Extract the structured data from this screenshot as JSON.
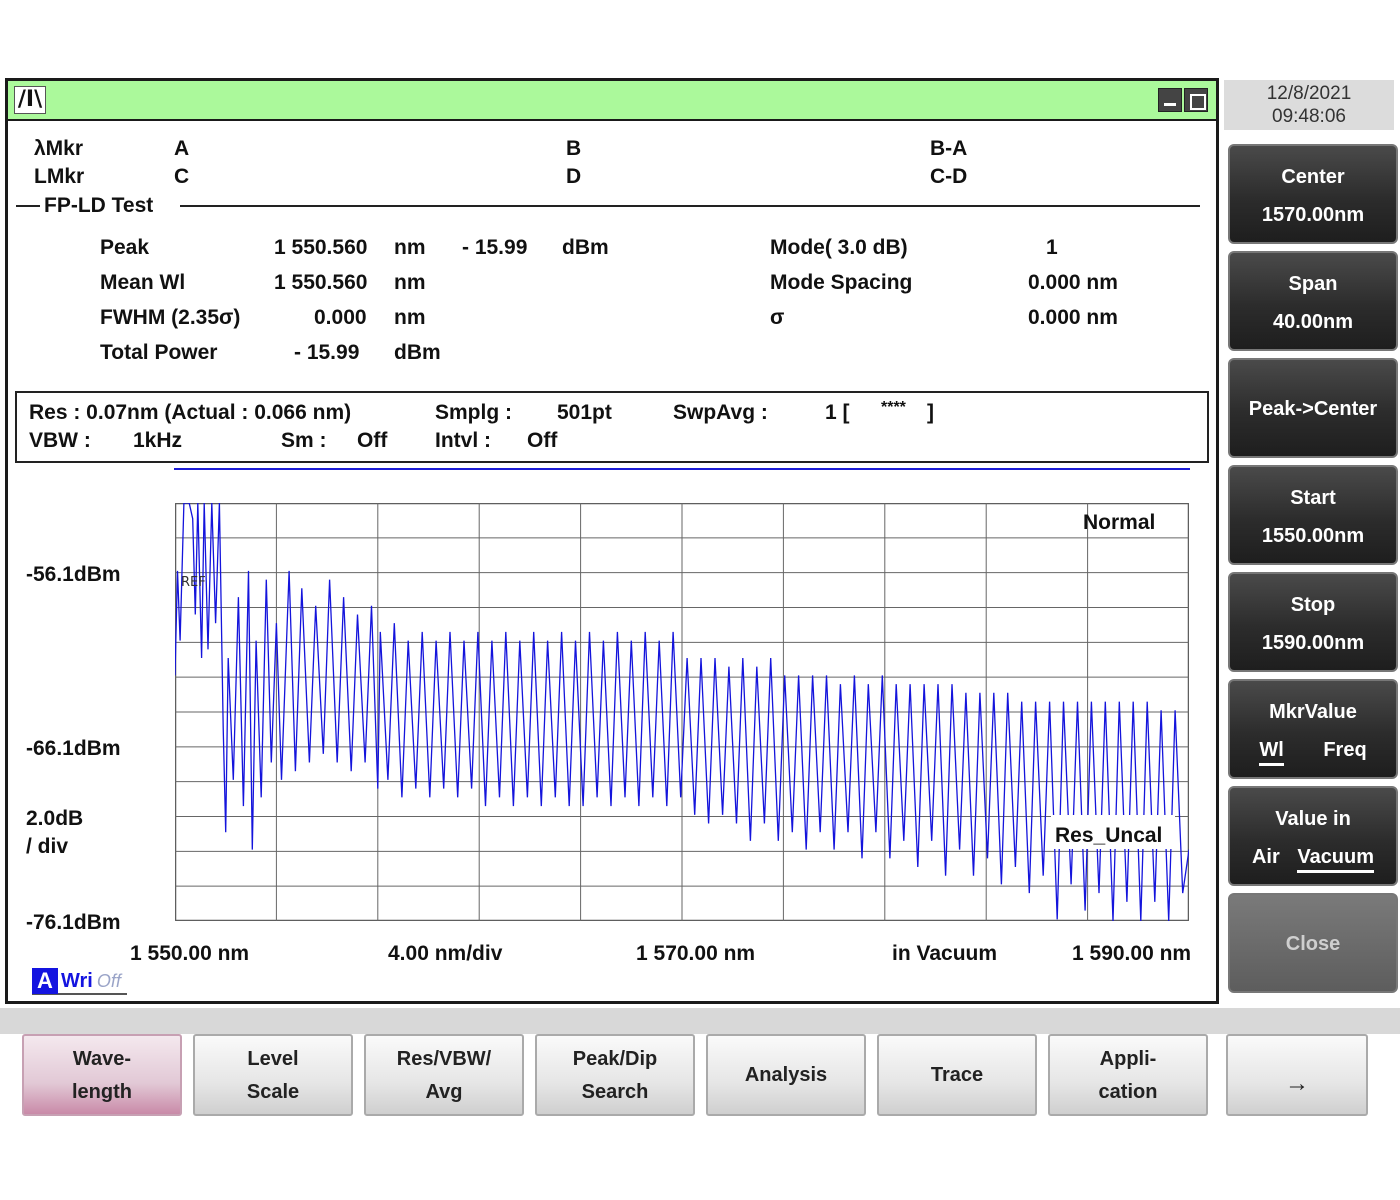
{
  "titlebar": {
    "logo": "/I\\"
  },
  "datetime": {
    "date": "12/8/2021",
    "time": "09:48:06"
  },
  "markers": {
    "lambda_label": "λMkr",
    "lambda_a": "A",
    "lambda_b": "B",
    "lambda_ba": "B-A",
    "level_label": "LMkr",
    "level_c": "C",
    "level_d": "D",
    "level_cd": "C-D"
  },
  "analysis": {
    "title": "FP-LD Test",
    "peak_label": "Peak",
    "peak_wl": "1 550.560",
    "peak_wl_unit": "nm",
    "peak_level": "- 15.99",
    "peak_level_unit": "dBm",
    "mean_label": "Mean Wl",
    "mean_wl": "1 550.560",
    "mean_unit": "nm",
    "fwhm_label": "FWHM (2.35σ)",
    "fwhm": "0.000",
    "fwhm_unit": "nm",
    "total_label": "Total Power",
    "total": "- 15.99",
    "total_unit": "dBm",
    "mode_label": "Mode(   3.0   dB)",
    "mode": "1",
    "spacing_label": "Mode Spacing",
    "spacing": "0.000 nm",
    "sigma_label": "σ",
    "sigma": "0.000 nm"
  },
  "settings": {
    "res": "Res :  0.07nm (Actual :  0.066 nm)",
    "smplg_label": "Smplg :",
    "smplg": "501pt",
    "swpavg_label": "SwpAvg :",
    "swpavg": "1 [",
    "swpavg_stars": "****",
    "swpavg_close": "]",
    "vbw_label": "VBW :",
    "vbw": "1kHz",
    "sm_label": "Sm :",
    "sm": "Off",
    "intvl_label": "Intvl :",
    "intvl": "Off"
  },
  "plot": {
    "y_top": "-56.1dBm",
    "y_mid": "-66.1dBm",
    "y_bottom": "-76.1dBm",
    "scale_1": "2.0dB",
    "scale_2": "/ div",
    "x_start": "1 550.00 nm",
    "x_div": "4.00 nm/div",
    "x_center": "1 570.00 nm",
    "x_medium": "in Vacuum",
    "x_stop": "1 590.00 nm",
    "mode_label": "Normal",
    "ref_label": "REF",
    "res_uncal": "Res_Uncal",
    "trace_a": "A",
    "trace_wri": "Wri",
    "trace_off": "Off"
  },
  "chart_data": {
    "type": "line",
    "xlabel": "",
    "ylabel": "",
    "xlim": [
      1550.0,
      1590.0
    ],
    "ylim": [
      -76.1,
      -52.1
    ],
    "grid": true,
    "x_ticks": [
      1550,
      1554,
      1558,
      1562,
      1566,
      1570,
      1574,
      1578,
      1582,
      1586,
      1590
    ],
    "y_gridlines_dB": 2.0,
    "color": "#1414dc",
    "series": [
      {
        "description_free": true,
        "points": [
          [
            1550.0,
            -62.0
          ],
          [
            1550.1,
            -56.0
          ],
          [
            1550.2,
            -60.0
          ],
          [
            1550.35,
            -52.1
          ],
          [
            1550.5,
            -52.1
          ],
          [
            1550.56,
            -52.1
          ],
          [
            1550.7,
            -53.0
          ],
          [
            1550.8,
            -58.5
          ],
          [
            1550.9,
            -52.1
          ],
          [
            1551.05,
            -61.0
          ],
          [
            1551.15,
            -52.1
          ],
          [
            1551.3,
            -60.5
          ],
          [
            1551.45,
            -52.1
          ],
          [
            1551.6,
            -59.0
          ],
          [
            1551.75,
            -52.1
          ],
          [
            1551.9,
            -65.0
          ],
          [
            1552.0,
            -71.0
          ],
          [
            1552.1,
            -61.0
          ],
          [
            1552.3,
            -68.0
          ],
          [
            1552.5,
            -57.5
          ],
          [
            1552.7,
            -69.5
          ],
          [
            1552.9,
            -56.0
          ],
          [
            1553.05,
            -72.0
          ],
          [
            1553.2,
            -60.0
          ],
          [
            1553.4,
            -69.0
          ],
          [
            1553.6,
            -56.5
          ],
          [
            1553.8,
            -67.0
          ],
          [
            1554.0,
            -59.0
          ],
          [
            1554.2,
            -68.0
          ],
          [
            1554.5,
            -56.0
          ],
          [
            1554.75,
            -67.5
          ],
          [
            1555.0,
            -57.0
          ],
          [
            1555.3,
            -67.0
          ],
          [
            1555.55,
            -58.0
          ],
          [
            1555.85,
            -66.5
          ],
          [
            1556.1,
            -56.5
          ],
          [
            1556.4,
            -67.0
          ],
          [
            1556.65,
            -57.5
          ],
          [
            1556.95,
            -67.5
          ],
          [
            1557.2,
            -58.5
          ],
          [
            1557.5,
            -67.0
          ],
          [
            1557.75,
            -58.0
          ],
          [
            1558.0,
            -68.5
          ],
          [
            1558.1,
            -59.5
          ],
          [
            1558.4,
            -68.0
          ],
          [
            1558.65,
            -59.0
          ],
          [
            1558.95,
            -69.0
          ],
          [
            1559.2,
            -60.0
          ],
          [
            1559.5,
            -68.5
          ],
          [
            1559.75,
            -59.5
          ],
          [
            1560.05,
            -69.0
          ],
          [
            1560.3,
            -60.0
          ],
          [
            1560.6,
            -68.5
          ],
          [
            1560.85,
            -59.5
          ],
          [
            1561.15,
            -69.0
          ],
          [
            1561.4,
            -60.0
          ],
          [
            1561.7,
            -68.5
          ],
          [
            1561.95,
            -59.5
          ],
          [
            1562.25,
            -69.5
          ],
          [
            1562.5,
            -60.0
          ],
          [
            1562.8,
            -69.0
          ],
          [
            1563.05,
            -59.5
          ],
          [
            1563.35,
            -69.5
          ],
          [
            1563.6,
            -60.0
          ],
          [
            1563.9,
            -69.0
          ],
          [
            1564.15,
            -59.5
          ],
          [
            1564.45,
            -69.5
          ],
          [
            1564.7,
            -60.0
          ],
          [
            1565.0,
            -69.0
          ],
          [
            1565.25,
            -59.5
          ],
          [
            1565.55,
            -69.5
          ],
          [
            1565.8,
            -60.0
          ],
          [
            1566.1,
            -69.5
          ],
          [
            1566.35,
            -59.5
          ],
          [
            1566.65,
            -69.0
          ],
          [
            1566.9,
            -60.0
          ],
          [
            1567.2,
            -69.5
          ],
          [
            1567.45,
            -59.5
          ],
          [
            1567.75,
            -69.0
          ],
          [
            1568.0,
            -60.0
          ],
          [
            1568.3,
            -69.5
          ],
          [
            1568.55,
            -59.5
          ],
          [
            1568.85,
            -69.0
          ],
          [
            1569.1,
            -60.0
          ],
          [
            1569.4,
            -69.5
          ],
          [
            1569.65,
            -59.5
          ],
          [
            1569.95,
            -69.0
          ],
          [
            1570.2,
            -61.0
          ],
          [
            1570.5,
            -70.0
          ],
          [
            1570.75,
            -61.0
          ],
          [
            1571.05,
            -70.5
          ],
          [
            1571.3,
            -61.0
          ],
          [
            1571.6,
            -70.0
          ],
          [
            1571.85,
            -61.5
          ],
          [
            1572.15,
            -70.5
          ],
          [
            1572.4,
            -61.0
          ],
          [
            1572.7,
            -71.5
          ],
          [
            1572.95,
            -61.5
          ],
          [
            1573.25,
            -70.5
          ],
          [
            1573.5,
            -61.0
          ],
          [
            1573.8,
            -71.5
          ],
          [
            1574.05,
            -62.0
          ],
          [
            1574.35,
            -71.0
          ],
          [
            1574.6,
            -62.0
          ],
          [
            1574.9,
            -72.0
          ],
          [
            1575.15,
            -62.0
          ],
          [
            1575.45,
            -71.0
          ],
          [
            1575.7,
            -62.0
          ],
          [
            1576.0,
            -72.0
          ],
          [
            1576.25,
            -62.5
          ],
          [
            1576.55,
            -71.0
          ],
          [
            1576.8,
            -62.0
          ],
          [
            1577.1,
            -72.5
          ],
          [
            1577.35,
            -62.5
          ],
          [
            1577.65,
            -71.0
          ],
          [
            1577.9,
            -62.0
          ],
          [
            1578.2,
            -72.5
          ],
          [
            1578.45,
            -62.5
          ],
          [
            1578.75,
            -71.5
          ],
          [
            1579.0,
            -62.5
          ],
          [
            1579.3,
            -73.0
          ],
          [
            1579.55,
            -62.5
          ],
          [
            1579.85,
            -71.5
          ],
          [
            1580.1,
            -62.5
          ],
          [
            1580.4,
            -73.5
          ],
          [
            1580.65,
            -62.5
          ],
          [
            1580.95,
            -72.0
          ],
          [
            1581.2,
            -63.0
          ],
          [
            1581.5,
            -73.5
          ],
          [
            1581.75,
            -63.0
          ],
          [
            1582.05,
            -72.5
          ],
          [
            1582.3,
            -63.0
          ],
          [
            1582.6,
            -74.0
          ],
          [
            1582.85,
            -63.0
          ],
          [
            1583.15,
            -73.0
          ],
          [
            1583.4,
            -63.5
          ],
          [
            1583.7,
            -74.5
          ],
          [
            1583.95,
            -63.5
          ],
          [
            1584.25,
            -73.5
          ],
          [
            1584.5,
            -63.5
          ],
          [
            1584.8,
            -76.0
          ],
          [
            1585.05,
            -63.5
          ],
          [
            1585.35,
            -74.0
          ],
          [
            1585.6,
            -63.5
          ],
          [
            1585.9,
            -75.5
          ],
          [
            1586.15,
            -63.5
          ],
          [
            1586.45,
            -74.5
          ],
          [
            1586.7,
            -63.5
          ],
          [
            1587.0,
            -76.1
          ],
          [
            1587.25,
            -63.5
          ],
          [
            1587.55,
            -75.0
          ],
          [
            1587.8,
            -63.5
          ],
          [
            1588.1,
            -76.1
          ],
          [
            1588.35,
            -63.5
          ],
          [
            1588.65,
            -75.0
          ],
          [
            1588.9,
            -64.0
          ],
          [
            1589.2,
            -76.1
          ],
          [
            1589.45,
            -64.0
          ],
          [
            1589.75,
            -74.5
          ],
          [
            1590.0,
            -72.0
          ]
        ]
      }
    ]
  },
  "softkeys": {
    "center_label": "Center",
    "center_value": "1570.00nm",
    "span_label": "Span",
    "span_value": "40.00nm",
    "peak_center": "Peak->Center",
    "start_label": "Start",
    "start_value": "1550.00nm",
    "stop_label": "Stop",
    "stop_value": "1590.00nm",
    "mkrvalue_label": "MkrValue",
    "mkrvalue_wl": "Wl",
    "mkrvalue_freq": "Freq",
    "valuein_label": "Value in",
    "valuein_air": "Air",
    "valuein_vacuum": "Vacuum",
    "close": "Close"
  },
  "fkeys": {
    "wavelength_1": "Wave-",
    "wavelength_2": "length",
    "level_1": "Level",
    "level_2": "Scale",
    "res_1": "Res/VBW/",
    "res_2": "Avg",
    "peak_1": "Peak/Dip",
    "peak_2": "Search",
    "analysis": "Analysis",
    "trace": "Trace",
    "appli_1": "Appli-",
    "appli_2": "cation",
    "next": "→"
  }
}
